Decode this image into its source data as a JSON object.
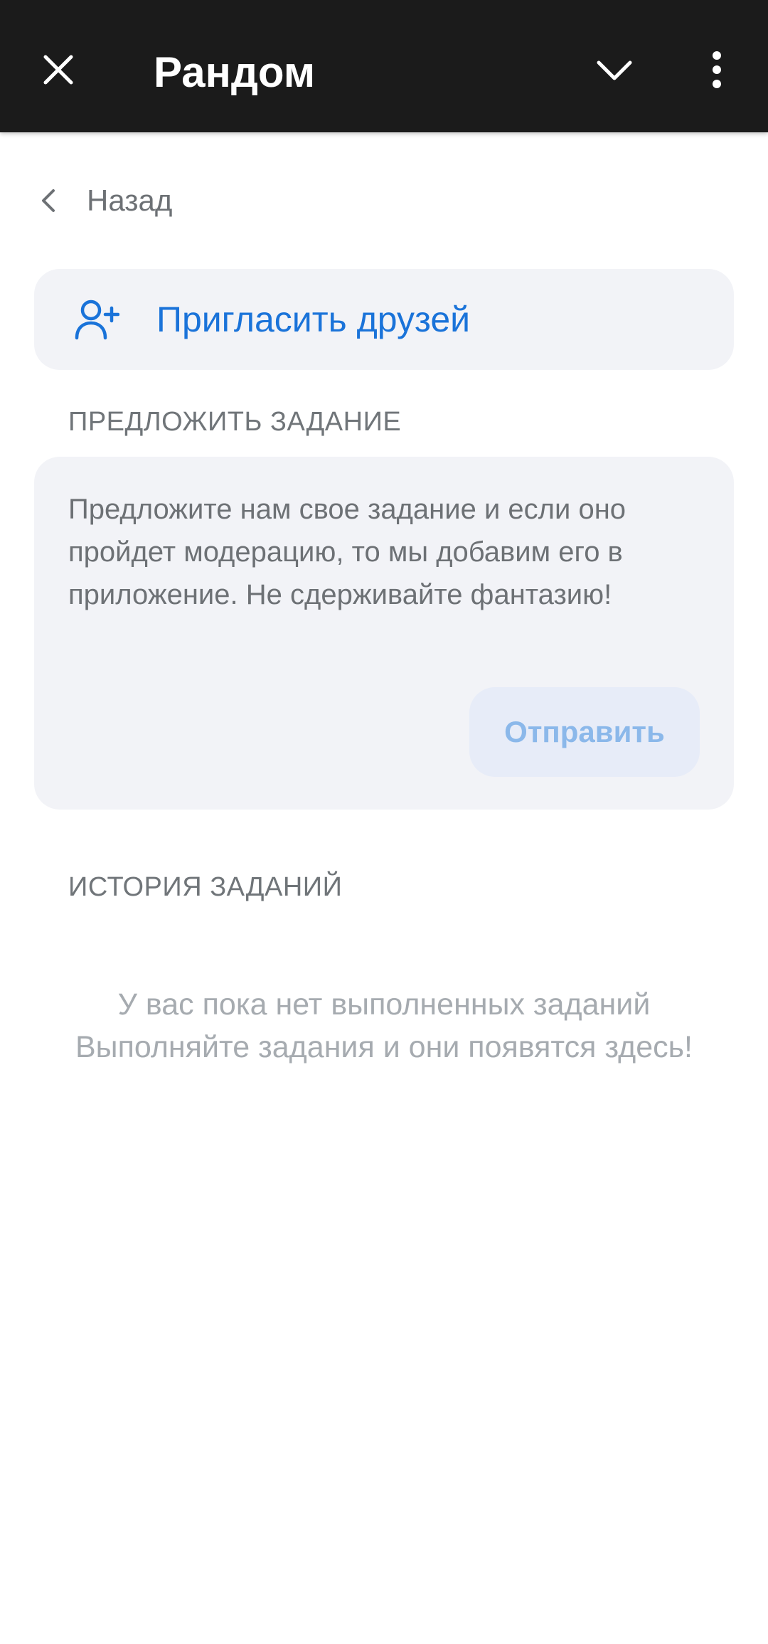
{
  "appbar": {
    "title": "Рандом",
    "close_icon": "close-icon",
    "chevron_icon": "chevron-down-icon",
    "more_icon": "more-vertical-icon",
    "background": "#1b1b1b"
  },
  "back": {
    "label": "Назад",
    "icon": "chevron-left-icon"
  },
  "invite": {
    "label": "Пригласить друзей",
    "icon": "add-user-icon",
    "accent": "#1a73d9"
  },
  "suggest": {
    "header": "ПРЕДЛОЖИТЬ ЗАДАНИЕ",
    "text": "Предложите нам свое задание и если оно пройдет модерацию, то мы добавим его в приложение. Не сдерживайте фантазию!",
    "send_label": "Отправить"
  },
  "history": {
    "header": "ИСТОРИЯ ЗАДАНИЙ",
    "empty_line1": "У вас пока нет выполненных заданий",
    "empty_line2": "Выполняйте задания и они появятся здесь!"
  }
}
